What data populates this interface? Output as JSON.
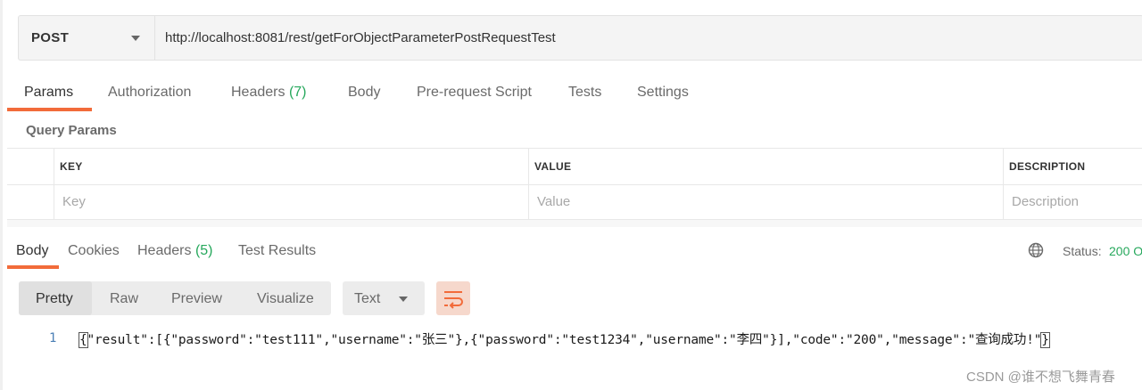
{
  "request": {
    "method": "POST",
    "url": "http://localhost:8081/rest/getForObjectParameterPostRequestTest",
    "tabs": {
      "params": "Params",
      "authorization": "Authorization",
      "headers": "Headers",
      "headers_count": "(7)",
      "body": "Body",
      "prerequest": "Pre-request Script",
      "tests": "Tests",
      "settings": "Settings"
    },
    "active_tab": "Params"
  },
  "query_params": {
    "title": "Query Params",
    "columns": {
      "key": "KEY",
      "value": "VALUE",
      "description": "DESCRIPTION"
    },
    "placeholders": {
      "key": "Key",
      "value": "Value",
      "description": "Description"
    }
  },
  "response": {
    "tabs": {
      "body": "Body",
      "cookies": "Cookies",
      "headers": "Headers",
      "headers_count": "(5)",
      "test_results": "Test Results"
    },
    "active_tab": "Body",
    "status_label": "Status:",
    "status_value": "200 O",
    "view_modes": [
      "Pretty",
      "Raw",
      "Preview",
      "Visualize"
    ],
    "active_view_mode": "Pretty",
    "format": "Text",
    "line_number": "1",
    "body_open": "{",
    "body_middle": "\"result\":[{\"password\":\"test111\",\"username\":\"张三\"},{\"password\":\"test1234\",\"username\":\"李四\"}],\"code\":\"200\",\"message\":\"查询成功!\"",
    "body_close": "}"
  },
  "watermark": "CSDN @谁不想飞舞青春",
  "colors": {
    "accent": "#f26b3a",
    "success": "#26a85c"
  },
  "icons": [
    "chevron-down-icon",
    "globe-icon",
    "wrap-lines-icon"
  ]
}
